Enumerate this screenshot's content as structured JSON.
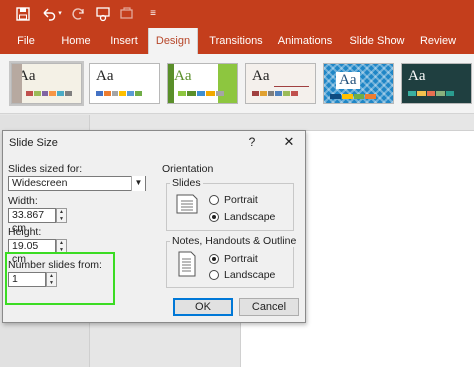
{
  "ribbon": {
    "tabs": [
      "File",
      "Home",
      "Insert",
      "Design",
      "Transitions",
      "Animations",
      "Slide Show",
      "Review"
    ],
    "active_tab": "Design",
    "themes": [
      {
        "name": "theme-1",
        "aa": "Aa",
        "bg": "#f4f1e6",
        "fg": "#333333"
      },
      {
        "name": "theme-2",
        "aa": "Aa",
        "bg": "#ffffff",
        "fg": "#222222"
      },
      {
        "name": "theme-3",
        "aa": "Aa",
        "bg": "#ffffff",
        "fg": "#5a8f2a"
      },
      {
        "name": "theme-4",
        "aa": "Aa",
        "bg": "#f4f0ec",
        "fg": "#333333"
      },
      {
        "name": "theme-5",
        "aa": "Aa",
        "bg": "#1f86c6",
        "fg": "#ffffff"
      },
      {
        "name": "theme-6",
        "aa": "Aa",
        "bg": "#1f3f40",
        "fg": "#ffffff"
      }
    ]
  },
  "dialog": {
    "title": "Slide Size",
    "help": "?",
    "close": "✕",
    "slides_sized_for_label": "Slides sized for:",
    "slides_sized_for_value": "Widescreen",
    "width_label": "Width:",
    "width_value": "33.867 cm",
    "height_label": "Height:",
    "height_value": "19.05 cm",
    "number_slides_label": "Number slides from:",
    "number_slides_value": "1",
    "orientation_label": "Orientation",
    "slides_group_label": "Slides",
    "notes_group_label": "Notes, Handouts & Outline",
    "portrait_label": "Portrait",
    "landscape_label": "Landscape",
    "slides_orientation": "Landscape",
    "notes_orientation": "Portrait",
    "ok_label": "OK",
    "cancel_label": "Cancel"
  },
  "colors": {
    "accent": "#c43e1c",
    "highlight": "#3bdc23"
  }
}
